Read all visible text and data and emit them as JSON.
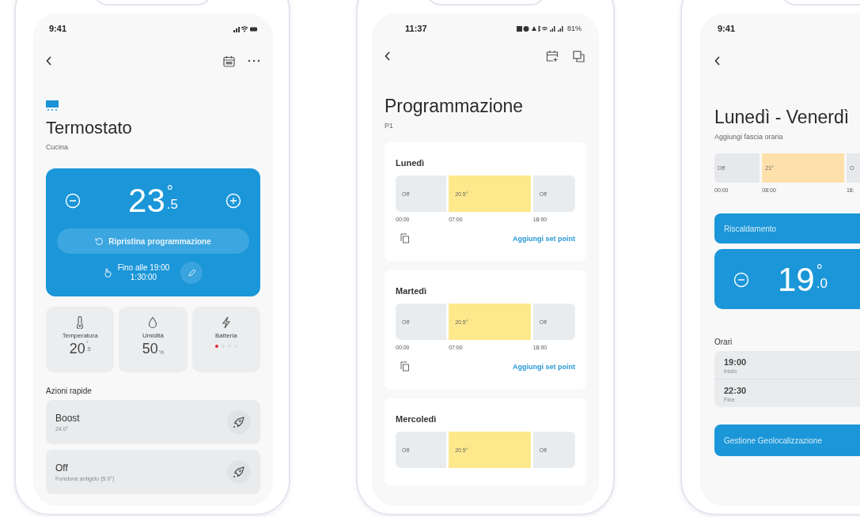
{
  "thermostat_screen": {
    "status_time": "9:41",
    "title": "Termostato",
    "room": "Cucina",
    "setpoint": {
      "whole": "23",
      "degree": "°",
      "decimal": ".5"
    },
    "reset_button": "Ripristina programmazione",
    "override": {
      "until": "Fino alle 19:00",
      "remaining": "1:30:00"
    },
    "tiles": [
      {
        "kind": "temperature",
        "label": "Temperatura",
        "value": "20",
        "unit_top": "°",
        "unit_bottom": ".5"
      },
      {
        "kind": "humidity",
        "label": "Umidità",
        "value": "50",
        "unit_bottom": "%"
      },
      {
        "kind": "battery",
        "label": "Batteria",
        "level": 0.25
      }
    ],
    "quick_actions_title": "Azioni rapide",
    "quick_actions": [
      {
        "title": "Boost",
        "subtitle": "24.0°"
      },
      {
        "title": "Off",
        "subtitle": "Funzione antigelo (5.0°)"
      }
    ]
  },
  "schedule_screen": {
    "status_time": "11:37",
    "battery_percent": "81%",
    "title": "Programmazione",
    "profile": "P1",
    "days": [
      {
        "name": "Lunedì",
        "segments": [
          {
            "label": "Off",
            "time": "00:00",
            "color": "#e9ecef"
          },
          {
            "label": "20.5°",
            "time": "07:00",
            "color": "#fde98c"
          },
          {
            "label": "Off",
            "time": "18:00",
            "color": "#e9ecef"
          }
        ],
        "add_label": "Aggiungi set point"
      },
      {
        "name": "Martedì",
        "segments": [
          {
            "label": "Off",
            "time": "00:00",
            "color": "#e9ecef"
          },
          {
            "label": "20.5°",
            "time": "07:00",
            "color": "#fde98c"
          },
          {
            "label": "Off",
            "time": "18:00",
            "color": "#e9ecef"
          }
        ],
        "add_label": "Aggiungi set point"
      },
      {
        "name": "Mercoledì",
        "segments": [
          {
            "label": "Off",
            "color": "#e9ecef"
          },
          {
            "label": "20.5°",
            "color": "#fde98c"
          },
          {
            "label": "Off",
            "color": "#e9ecef"
          }
        ]
      }
    ]
  },
  "timeslot_screen": {
    "status_time": "9:41",
    "title": "Lunedì - Venerdì",
    "subtitle": "Aggiungi fascia oraria",
    "segments": [
      {
        "label": "Off",
        "time": "00:00",
        "color": "#e6e8eb"
      },
      {
        "label": "21°",
        "time": "08:00",
        "color": "#fde0aa"
      },
      {
        "label": "O",
        "time": "18:",
        "color": "#e6e8eb"
      }
    ],
    "mode_label": "Riscaldamento",
    "setpoint": {
      "whole": "19",
      "degree": "°",
      "decimal": ".0"
    },
    "hours_title": "Orari",
    "hours": [
      {
        "time": "19:00",
        "label": "Inizio"
      },
      {
        "time": "22:30",
        "label": "Fine"
      }
    ],
    "geo_button": "Gestione Geolocalizzazione"
  }
}
